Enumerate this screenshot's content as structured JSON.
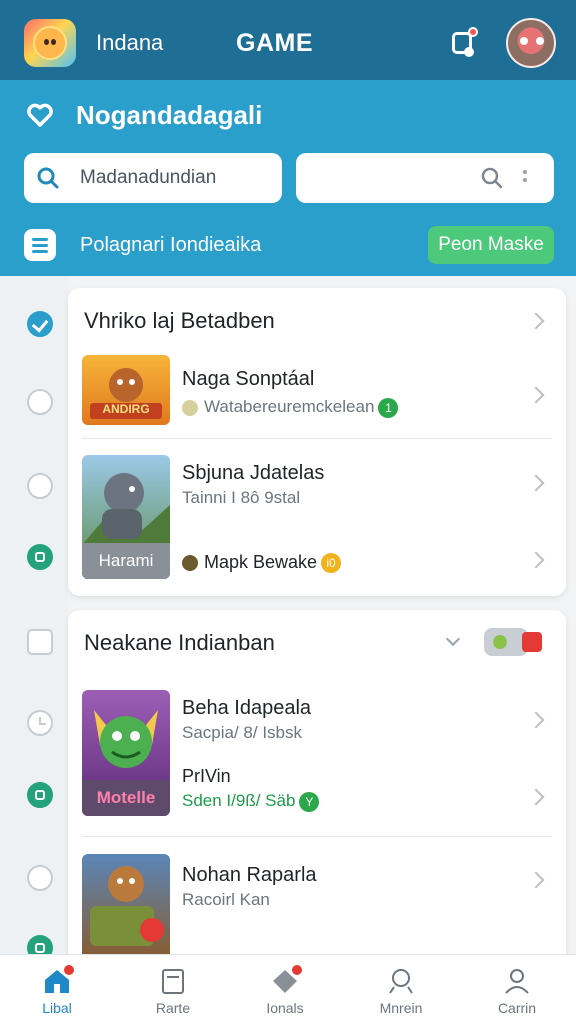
{
  "status_bar": {},
  "header": {
    "brand": "Indana",
    "title": "GAME",
    "icons": [
      "app-logo",
      "notification-icon",
      "profile-avatar"
    ]
  },
  "hero": {
    "title": "Nogandadagali",
    "search_left_value": "Madanadundian",
    "search_right_placeholder": "",
    "subtitle": "Polagnari Iondieaika",
    "pro_button": "Peon Maske"
  },
  "cards": [
    {
      "title": "Vhriko laj Betadben",
      "games": [
        {
          "name": "Naga Sonptáal",
          "meta": "Watabereuremckelean",
          "badge": "1",
          "badge_color": "#2aa84a",
          "thumb_label": "ANDIRG"
        },
        {
          "name": "Sbjuna Jdatelas",
          "meta": "Tainni I 8ô 9stal",
          "thumb_label": "Harami",
          "extra": "Mapk Bewake",
          "extra_badge": "i0",
          "extra_badge_color": "#f2b21c"
        }
      ]
    },
    {
      "title": "Neakane Indianban",
      "games": [
        {
          "name": "Beha Idapeala",
          "meta": "Sacpia/ 8/ Isbsk",
          "thumb_label": "Motelle",
          "sub_name": "PrIVin",
          "sub_meta": "Sden I/9ß/ Säb",
          "sub_badge": "Y",
          "sub_badge_color": "#2aa84a"
        },
        {
          "name": "Nohan Raparla",
          "meta": "Racoirl Kan"
        }
      ]
    }
  ],
  "bottom_nav": [
    {
      "label": "Libal",
      "icon": "home-icon",
      "active": true,
      "dot": true
    },
    {
      "label": "Rarte",
      "icon": "clipboard-icon",
      "active": false,
      "dot": false
    },
    {
      "label": "Ionals",
      "icon": "tag-icon",
      "active": false,
      "dot": true
    },
    {
      "label": "Mnrein",
      "icon": "search-icon",
      "active": false,
      "dot": false
    },
    {
      "label": "Carrin",
      "icon": "profile-icon",
      "active": false,
      "dot": false
    }
  ],
  "colors": {
    "header_dark": "#1f6e95",
    "header_blue": "#2b9fcc",
    "accent_green": "#4cc97a",
    "nav_active": "#1e88c9"
  }
}
